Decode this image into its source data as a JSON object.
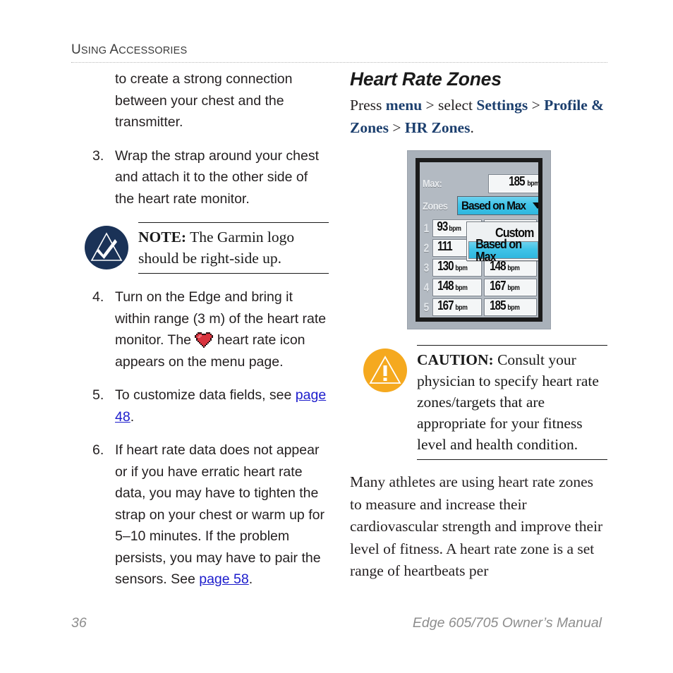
{
  "header": {
    "title_first_cap": "U",
    "title_first_rest": "SING ",
    "title_second_cap": "A",
    "title_second_rest": "CCESSORIES"
  },
  "left_column": {
    "continuation_text": "to create a strong connection between your chest and the transmitter.",
    "steps": [
      {
        "number": "3.",
        "text": "Wrap the strap around your chest and attach it to the other side of the heart rate monitor."
      },
      {
        "number": "4.",
        "text_before_icon": "Turn on the Edge and bring it within range (3 m) of the heart rate monitor. The ",
        "icon": "heart-rate-icon",
        "text_after_icon": " heart rate icon appears on the menu page."
      },
      {
        "number": "5.",
        "text_before_link": "To customize data fields, see ",
        "link": "page 48",
        "text_after_link": "."
      },
      {
        "number": "6.",
        "text_before_link": "If heart rate data does not appear or if you have erratic heart rate data, you may have to tighten the strap on your chest or warm up for 5–10 minutes. If the problem persists, you may have to pair the sensors. See ",
        "link": "page 58",
        "text_after_link": "."
      }
    ],
    "note": {
      "icon": "note-check-triangle-icon",
      "icon_color": "#1a3257",
      "label": "NOTE:",
      "text": " The Garmin logo should be right-side up."
    }
  },
  "right_column": {
    "section_title": "Heart Rate Zones",
    "nav_path": {
      "press": "Press ",
      "key1": "menu",
      "sep1": " > select ",
      "key2": "Settings",
      "sep2": " > ",
      "key3": "Profile & Zones",
      "sep3": " > ",
      "key4": "HR Zones",
      "period": "."
    },
    "caution": {
      "icon": "caution-exclamation-triangle-icon",
      "icon_color": "#f5a91f",
      "label": "CAUTION:",
      "text": " Consult your physician to specify heart rate zones/targets that are appropriate for your fitness level and health condition."
    },
    "body_paragraph": "Many athletes are using heart rate zones to measure and increase their cardiovascular strength and improve their level of fitness. A heart rate zone is a set range of heartbeats per"
  },
  "device_screenshot": {
    "accent_cyan": "#3fc3e8",
    "lcd_background": "#b3bac2",
    "max_label": "Max:",
    "max_value": "185",
    "max_unit": "bpm",
    "zones_label": "Zones",
    "zones_selector_value": "Based on Max",
    "dropdown_options": [
      {
        "label": "Custom",
        "selected": false
      },
      {
        "label": "Based on Max",
        "selected": true
      }
    ],
    "zone_rows": [
      {
        "num": "1",
        "low": "93",
        "low_unit": "bpm",
        "high": "",
        "high_unit": ""
      },
      {
        "num": "2",
        "low": "111",
        "low_unit": "",
        "high": "",
        "high_unit": ""
      },
      {
        "num": "3",
        "low": "130",
        "low_unit": "bpm",
        "high": "148",
        "high_unit": "bpm"
      },
      {
        "num": "4",
        "low": "148",
        "low_unit": "bpm",
        "high": "167",
        "high_unit": "bpm"
      },
      {
        "num": "5",
        "low": "167",
        "low_unit": "bpm",
        "high": "185",
        "high_unit": "bpm"
      }
    ]
  },
  "footer": {
    "page_number": "36",
    "manual_title": "Edge 605/705 Owner’s Manual"
  }
}
